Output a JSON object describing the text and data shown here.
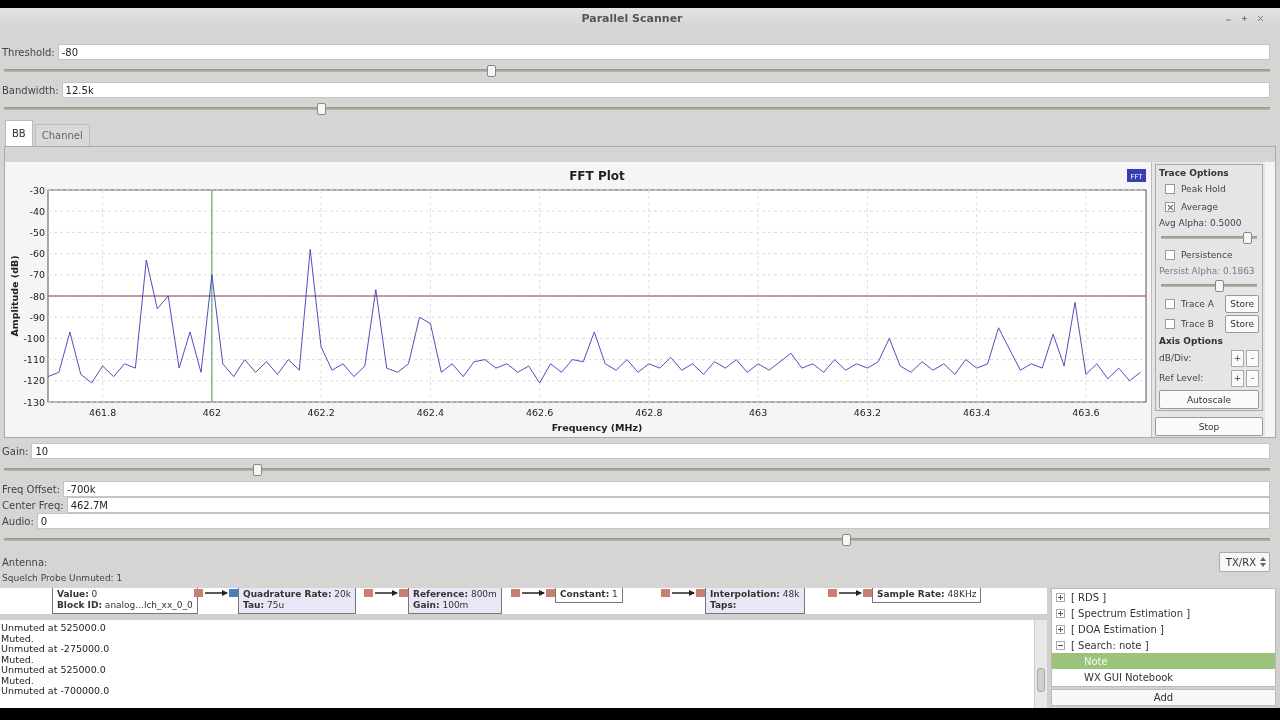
{
  "window": {
    "title": "Parallel Scanner"
  },
  "top_controls": [
    {
      "kind": "slider_field",
      "label": "Threshold:",
      "value": "-80",
      "level": 0.385
    },
    {
      "kind": "slider_field",
      "label": "Bandwidth:",
      "value": "12.5k",
      "level": 0.25
    }
  ],
  "tabs": [
    {
      "label": "BB",
      "selected": true
    },
    {
      "label": "Channel",
      "selected": false
    }
  ],
  "fft_plot": {
    "chart_data": {
      "type": "line",
      "title": "FFT Plot",
      "xlabel": "Frequency (MHz)",
      "ylabel": "Amplitude (dB)",
      "x": [
        461.7,
        461.72,
        461.74,
        461.76,
        461.78,
        461.8,
        461.82,
        461.84,
        461.86,
        461.88,
        461.9,
        461.92,
        461.94,
        461.96,
        461.98,
        462,
        462.02,
        462.04,
        462.06,
        462.08,
        462.1,
        462.12,
        462.14,
        462.16,
        462.18,
        462.2,
        462.22,
        462.24,
        462.26,
        462.28,
        462.3,
        462.32,
        462.34,
        462.36,
        462.38,
        462.4,
        462.42,
        462.44,
        462.46,
        462.48,
        462.5,
        462.52,
        462.54,
        462.56,
        462.58,
        462.6,
        462.62,
        462.64,
        462.66,
        462.68,
        462.7,
        462.72,
        462.74,
        462.76,
        462.78,
        462.8,
        462.82,
        462.84,
        462.86,
        462.88,
        462.9,
        462.92,
        462.94,
        462.96,
        462.98,
        463,
        463.02,
        463.04,
        463.06,
        463.08,
        463.1,
        463.12,
        463.14,
        463.16,
        463.18,
        463.2,
        463.22,
        463.24,
        463.26,
        463.28,
        463.3,
        463.32,
        463.34,
        463.36,
        463.38,
        463.4,
        463.42,
        463.44,
        463.46,
        463.48,
        463.5,
        463.52,
        463.54,
        463.56,
        463.58,
        463.6,
        463.62,
        463.64,
        463.66,
        463.68,
        463.7
      ],
      "series": [
        {
          "name": "FFT",
          "color": "#3b3bb5",
          "values": [
            -118,
            -116,
            -97,
            -117,
            -121,
            -113,
            -118,
            -112,
            -114,
            -63,
            -86,
            -80,
            -114,
            -97,
            -116,
            -70,
            -112,
            -118,
            -110,
            -116,
            -111,
            -117,
            -110,
            -115,
            -58,
            -104,
            -115,
            -112,
            -118,
            -113,
            -77,
            -114,
            -116,
            -112,
            -90,
            -93,
            -116,
            -112,
            -118,
            -111,
            -110,
            -114,
            -112,
            -116,
            -113,
            -121,
            -112,
            -116,
            -110,
            -111,
            -97,
            -112,
            -115,
            -110,
            -116,
            -112,
            -114,
            -109,
            -115,
            -112,
            -117,
            -111,
            -114,
            -110,
            -116,
            -112,
            -115,
            -111,
            -107,
            -114,
            -112,
            -116,
            -110,
            -115,
            -112,
            -114,
            -111,
            -100,
            -113,
            -116,
            -111,
            -115,
            -112,
            -117,
            -110,
            -114,
            -112,
            -95,
            -105,
            -115,
            -112,
            -114,
            -98,
            -113,
            -83,
            -117,
            -112,
            -119,
            -114,
            -120,
            -116
          ]
        }
      ],
      "xlim": [
        461.7,
        463.71
      ],
      "ylim": [
        -130,
        -30
      ],
      "xticks": [
        461.8,
        462,
        462.2,
        462.4,
        462.6,
        462.8,
        463,
        463.2,
        463.4,
        463.6
      ],
      "yticks": [
        -30,
        -40,
        -50,
        -60,
        -70,
        -80,
        -90,
        -100,
        -110,
        -120,
        -130
      ],
      "grid": true,
      "ref_lines": [
        {
          "axis": "y",
          "value": -80
        },
        {
          "axis": "x",
          "value": 462
        }
      ]
    },
    "side_panel": [
      {
        "kind": "heading",
        "text": "Trace Options"
      },
      {
        "kind": "checkbox",
        "label": "Peak Hold",
        "checked": false
      },
      {
        "kind": "checkbox",
        "label": "Average",
        "checked": true
      },
      {
        "kind": "label",
        "text": "Avg Alpha: 0.5000",
        "disabled": false
      },
      {
        "kind": "slider",
        "level": 0.9
      },
      {
        "kind": "checkbox",
        "label": "Persistence",
        "checked": false
      },
      {
        "kind": "label",
        "text": "Persist Alpha: 0.1863",
        "disabled": true
      },
      {
        "kind": "slider",
        "level": 0.6
      },
      {
        "kind": "checkbox_store",
        "label": "Trace A",
        "checked": false,
        "button": "Store"
      },
      {
        "kind": "checkbox_store",
        "label": "Trace B",
        "checked": false,
        "button": "Store"
      },
      {
        "kind": "heading",
        "text": "Axis Options"
      },
      {
        "kind": "stepper",
        "label": "dB/Div:",
        "plus": "+",
        "minus": "-"
      },
      {
        "kind": "stepper",
        "label": "Ref Level:",
        "plus": "+",
        "minus": "-"
      },
      {
        "kind": "button",
        "label": "Autoscale"
      }
    ],
    "stop_button": "Stop"
  },
  "bottom_controls": [
    {
      "kind": "slider_field",
      "label": "Gain:",
      "value": "10",
      "level": 0.2
    },
    {
      "kind": "field",
      "label": "Freq Offset:",
      "value": "-700k"
    },
    {
      "kind": "field",
      "label": "Center Freq:",
      "value": "462.7M"
    },
    {
      "kind": "slider_field",
      "label": "Audio:",
      "value": "0",
      "level": 0.665
    }
  ],
  "antenna": {
    "label": "Antenna:",
    "value": "TX/RX"
  },
  "squelch_probe": "Squelch Probe Unmuted: 1",
  "flow_graph": {
    "blocks": [
      {
        "lines": [
          "**Value:** 0",
          "**Block ID:** analog...lch_xx_0_0"
        ]
      },
      {
        "lines": [
          "**Quadrature Rate:** 20k",
          "**Tau:** 75u"
        ]
      },
      {
        "lines": [
          "**Reference:** 800m",
          "**Gain:** 100m"
        ]
      },
      {
        "lines": [
          "**Constant:** 1"
        ]
      },
      {
        "lines": [
          "**Interpolation:** 48k",
          "**Taps:**"
        ]
      },
      {
        "lines": [
          "**Sample Rate:** 48KHz"
        ]
      }
    ]
  },
  "log": [
    "Unmuted at 525000.0",
    "Muted.",
    "Unmuted at -275000.0",
    "Muted.",
    "Unmuted at 525000.0",
    "Muted.",
    "Unmuted at -700000.0"
  ],
  "block_tree": {
    "items": [
      {
        "label": "[ RDS ]",
        "expanded": false
      },
      {
        "label": "[ Spectrum Estimation ]",
        "expanded": false
      },
      {
        "label": "[ DOA Estimation ]",
        "expanded": false
      },
      {
        "label": "[ Search: note ]",
        "expanded": true,
        "children": [
          {
            "label": "Note",
            "selected": true
          },
          {
            "label": "WX GUI Notebook",
            "selected": false
          }
        ]
      }
    ],
    "add_button": "Add"
  }
}
